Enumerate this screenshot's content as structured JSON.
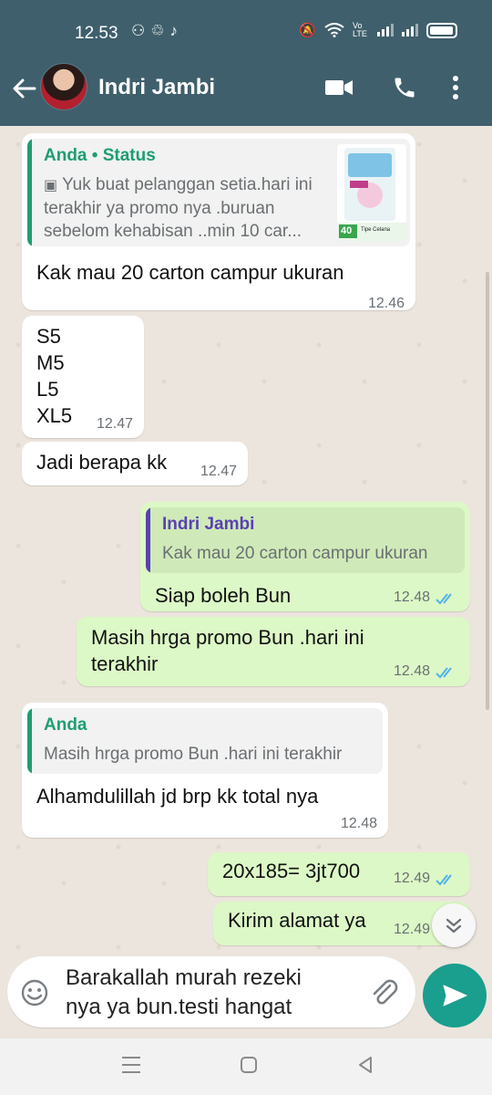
{
  "status_bar": {
    "time": "12.53",
    "lte_label": "Vo LTE"
  },
  "header": {
    "contact_name": "Indri Jambi",
    "icons": [
      "back-arrow-icon",
      "avatar",
      "video-call-icon",
      "phone-icon",
      "more-vert-icon"
    ]
  },
  "messages": [
    {
      "direction": "in",
      "quote": {
        "author": "Anda • Status",
        "text": "Yuk buat pelanggan setia.hari ini terakhir ya promo nya .buruan sebelom kehabisan ..min 10 car...",
        "thumb_label": "40",
        "thumb_caption": "Tipe Celana"
      },
      "text": "Kak mau 20 carton campur ukuran",
      "time": "12.46"
    },
    {
      "direction": "in",
      "text": "S5\nM5\nL5\nXL5",
      "time": "12.47"
    },
    {
      "direction": "in",
      "text": "Jadi berapa kk",
      "time": "12.47"
    },
    {
      "direction": "out",
      "quote": {
        "author": "Indri Jambi",
        "text": "Kak mau 20 carton campur ukuran"
      },
      "text": "Siap boleh Bun",
      "time": "12.48",
      "status": "read"
    },
    {
      "direction": "out",
      "text": "Masih hrga promo Bun .hari ini\nterakhir",
      "time": "12.48",
      "status": "read"
    },
    {
      "direction": "in",
      "quote": {
        "author": "Anda",
        "text": "Masih hrga promo Bun .hari ini terakhir"
      },
      "text": "Alhamdulillah jd brp kk total nya",
      "time": "12.48"
    },
    {
      "direction": "out",
      "text": "20x185=  3jt700",
      "time": "12.49",
      "status": "read"
    },
    {
      "direction": "out",
      "text": "Kirim alamat ya",
      "time": "12.49",
      "status": "read"
    }
  ],
  "composer": {
    "value": "Barakallah murah rezeki\nnya ya bun.testi hangat"
  },
  "colors": {
    "header_bg": "#3f5f6c",
    "incoming_bubble": "#ffffff",
    "outgoing_bubble": "#dcf8c6",
    "read_ticks": "#4fb3e8",
    "quote_anda": "#1f9d72",
    "quote_contact": "#5b3fb3",
    "send_button": "#1a9e8e"
  }
}
